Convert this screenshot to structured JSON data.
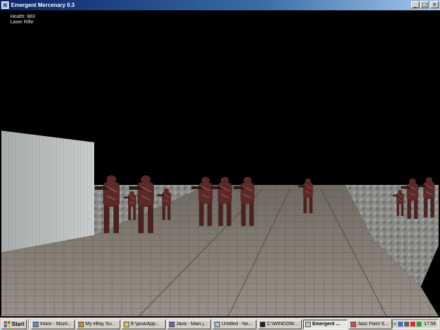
{
  "window": {
    "title": "Emergent Mercenary 0.3",
    "minimize_glyph": "_",
    "maximize_glyph": "□",
    "close_glyph": "×"
  },
  "hud": {
    "health": "Health: 883",
    "weapon": "Laser Rifle"
  },
  "scene": {
    "sky_color": "#000000",
    "floor_color": "#8a8278",
    "wall_color": "#b8b8b8",
    "enemy_color": "#5a2a28",
    "enemy_count": 11
  },
  "taskbar": {
    "start_label": "Start",
    "tasks": [
      {
        "label": "Inbox - Mozil...",
        "icon": "mozilla-mail-icon",
        "color": "#5a8ad0",
        "active": false
      },
      {
        "label": "My eBay Su...",
        "icon": "browser-icon",
        "color": "#d08a30",
        "active": false
      },
      {
        "label": "E:\\java\\App...",
        "icon": "folder-icon",
        "color": "#e6c34a",
        "active": false
      },
      {
        "label": "Java - Main.j...",
        "icon": "java-ide-icon",
        "color": "#7a5ab0",
        "active": false
      },
      {
        "label": "Untitled - No...",
        "icon": "notepad-icon",
        "color": "#9cc0e8",
        "active": false
      },
      {
        "label": "C:\\WINDOW...",
        "icon": "console-icon",
        "color": "#202020",
        "active": false
      },
      {
        "label": "Emergent ...",
        "icon": "game-window-icon",
        "color": "#c0c0c0",
        "active": true
      },
      {
        "label": "Jasc Paint S...",
        "icon": "paint-icon",
        "color": "#d05050",
        "active": false
      }
    ],
    "tray_chevron": "«",
    "clock": "17:56",
    "tray_icons": [
      {
        "name": "network-icon",
        "color": "#3a70c0"
      },
      {
        "name": "volume-icon",
        "color": "#606060"
      },
      {
        "name": "security-icon",
        "color": "#d03030"
      },
      {
        "name": "antivirus-icon",
        "color": "#30a030"
      }
    ]
  }
}
